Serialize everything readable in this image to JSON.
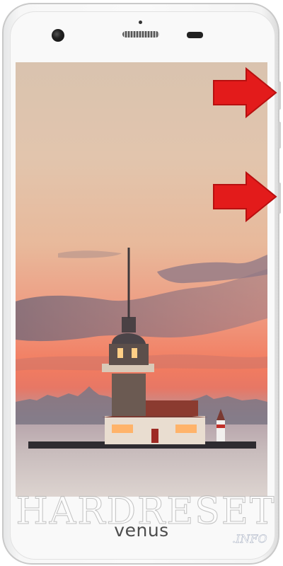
{
  "device": {
    "brand": "venus",
    "wallpaper": "maiden-tower-istanbul-sunset"
  },
  "watermark": {
    "text": "HARDRESET",
    "suffix": ".INFO"
  },
  "annotations": {
    "arrow_top": "red-arrow-icon",
    "arrow_bottom": "red-arrow-icon",
    "arrow_color": "#e31b1b"
  },
  "colors": {
    "phone_body": "#f7f7f7",
    "sky_top": "#d9c3af",
    "sky_glow": "#f27c60",
    "water": "#c8bdbd"
  }
}
